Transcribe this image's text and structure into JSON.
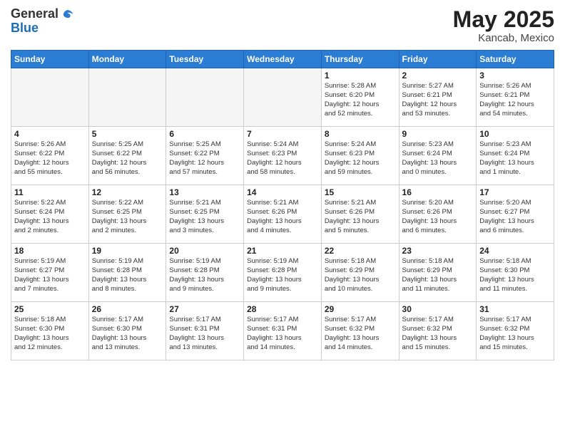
{
  "header": {
    "logo_general": "General",
    "logo_blue": "Blue",
    "month_year": "May 2025",
    "location": "Kancab, Mexico"
  },
  "weekdays": [
    "Sunday",
    "Monday",
    "Tuesday",
    "Wednesday",
    "Thursday",
    "Friday",
    "Saturday"
  ],
  "weeks": [
    [
      {
        "day": "",
        "info": ""
      },
      {
        "day": "",
        "info": ""
      },
      {
        "day": "",
        "info": ""
      },
      {
        "day": "",
        "info": ""
      },
      {
        "day": "1",
        "info": "Sunrise: 5:28 AM\nSunset: 6:20 PM\nDaylight: 12 hours\nand 52 minutes."
      },
      {
        "day": "2",
        "info": "Sunrise: 5:27 AM\nSunset: 6:21 PM\nDaylight: 12 hours\nand 53 minutes."
      },
      {
        "day": "3",
        "info": "Sunrise: 5:26 AM\nSunset: 6:21 PM\nDaylight: 12 hours\nand 54 minutes."
      }
    ],
    [
      {
        "day": "4",
        "info": "Sunrise: 5:26 AM\nSunset: 6:22 PM\nDaylight: 12 hours\nand 55 minutes."
      },
      {
        "day": "5",
        "info": "Sunrise: 5:25 AM\nSunset: 6:22 PM\nDaylight: 12 hours\nand 56 minutes."
      },
      {
        "day": "6",
        "info": "Sunrise: 5:25 AM\nSunset: 6:22 PM\nDaylight: 12 hours\nand 57 minutes."
      },
      {
        "day": "7",
        "info": "Sunrise: 5:24 AM\nSunset: 6:23 PM\nDaylight: 12 hours\nand 58 minutes."
      },
      {
        "day": "8",
        "info": "Sunrise: 5:24 AM\nSunset: 6:23 PM\nDaylight: 12 hours\nand 59 minutes."
      },
      {
        "day": "9",
        "info": "Sunrise: 5:23 AM\nSunset: 6:24 PM\nDaylight: 13 hours\nand 0 minutes."
      },
      {
        "day": "10",
        "info": "Sunrise: 5:23 AM\nSunset: 6:24 PM\nDaylight: 13 hours\nand 1 minute."
      }
    ],
    [
      {
        "day": "11",
        "info": "Sunrise: 5:22 AM\nSunset: 6:24 PM\nDaylight: 13 hours\nand 2 minutes."
      },
      {
        "day": "12",
        "info": "Sunrise: 5:22 AM\nSunset: 6:25 PM\nDaylight: 13 hours\nand 2 minutes."
      },
      {
        "day": "13",
        "info": "Sunrise: 5:21 AM\nSunset: 6:25 PM\nDaylight: 13 hours\nand 3 minutes."
      },
      {
        "day": "14",
        "info": "Sunrise: 5:21 AM\nSunset: 6:26 PM\nDaylight: 13 hours\nand 4 minutes."
      },
      {
        "day": "15",
        "info": "Sunrise: 5:21 AM\nSunset: 6:26 PM\nDaylight: 13 hours\nand 5 minutes."
      },
      {
        "day": "16",
        "info": "Sunrise: 5:20 AM\nSunset: 6:26 PM\nDaylight: 13 hours\nand 6 minutes."
      },
      {
        "day": "17",
        "info": "Sunrise: 5:20 AM\nSunset: 6:27 PM\nDaylight: 13 hours\nand 6 minutes."
      }
    ],
    [
      {
        "day": "18",
        "info": "Sunrise: 5:19 AM\nSunset: 6:27 PM\nDaylight: 13 hours\nand 7 minutes."
      },
      {
        "day": "19",
        "info": "Sunrise: 5:19 AM\nSunset: 6:28 PM\nDaylight: 13 hours\nand 8 minutes."
      },
      {
        "day": "20",
        "info": "Sunrise: 5:19 AM\nSunset: 6:28 PM\nDaylight: 13 hours\nand 9 minutes."
      },
      {
        "day": "21",
        "info": "Sunrise: 5:19 AM\nSunset: 6:28 PM\nDaylight: 13 hours\nand 9 minutes."
      },
      {
        "day": "22",
        "info": "Sunrise: 5:18 AM\nSunset: 6:29 PM\nDaylight: 13 hours\nand 10 minutes."
      },
      {
        "day": "23",
        "info": "Sunrise: 5:18 AM\nSunset: 6:29 PM\nDaylight: 13 hours\nand 11 minutes."
      },
      {
        "day": "24",
        "info": "Sunrise: 5:18 AM\nSunset: 6:30 PM\nDaylight: 13 hours\nand 11 minutes."
      }
    ],
    [
      {
        "day": "25",
        "info": "Sunrise: 5:18 AM\nSunset: 6:30 PM\nDaylight: 13 hours\nand 12 minutes."
      },
      {
        "day": "26",
        "info": "Sunrise: 5:17 AM\nSunset: 6:30 PM\nDaylight: 13 hours\nand 13 minutes."
      },
      {
        "day": "27",
        "info": "Sunrise: 5:17 AM\nSunset: 6:31 PM\nDaylight: 13 hours\nand 13 minutes."
      },
      {
        "day": "28",
        "info": "Sunrise: 5:17 AM\nSunset: 6:31 PM\nDaylight: 13 hours\nand 14 minutes."
      },
      {
        "day": "29",
        "info": "Sunrise: 5:17 AM\nSunset: 6:32 PM\nDaylight: 13 hours\nand 14 minutes."
      },
      {
        "day": "30",
        "info": "Sunrise: 5:17 AM\nSunset: 6:32 PM\nDaylight: 13 hours\nand 15 minutes."
      },
      {
        "day": "31",
        "info": "Sunrise: 5:17 AM\nSunset: 6:32 PM\nDaylight: 13 hours\nand 15 minutes."
      }
    ]
  ]
}
